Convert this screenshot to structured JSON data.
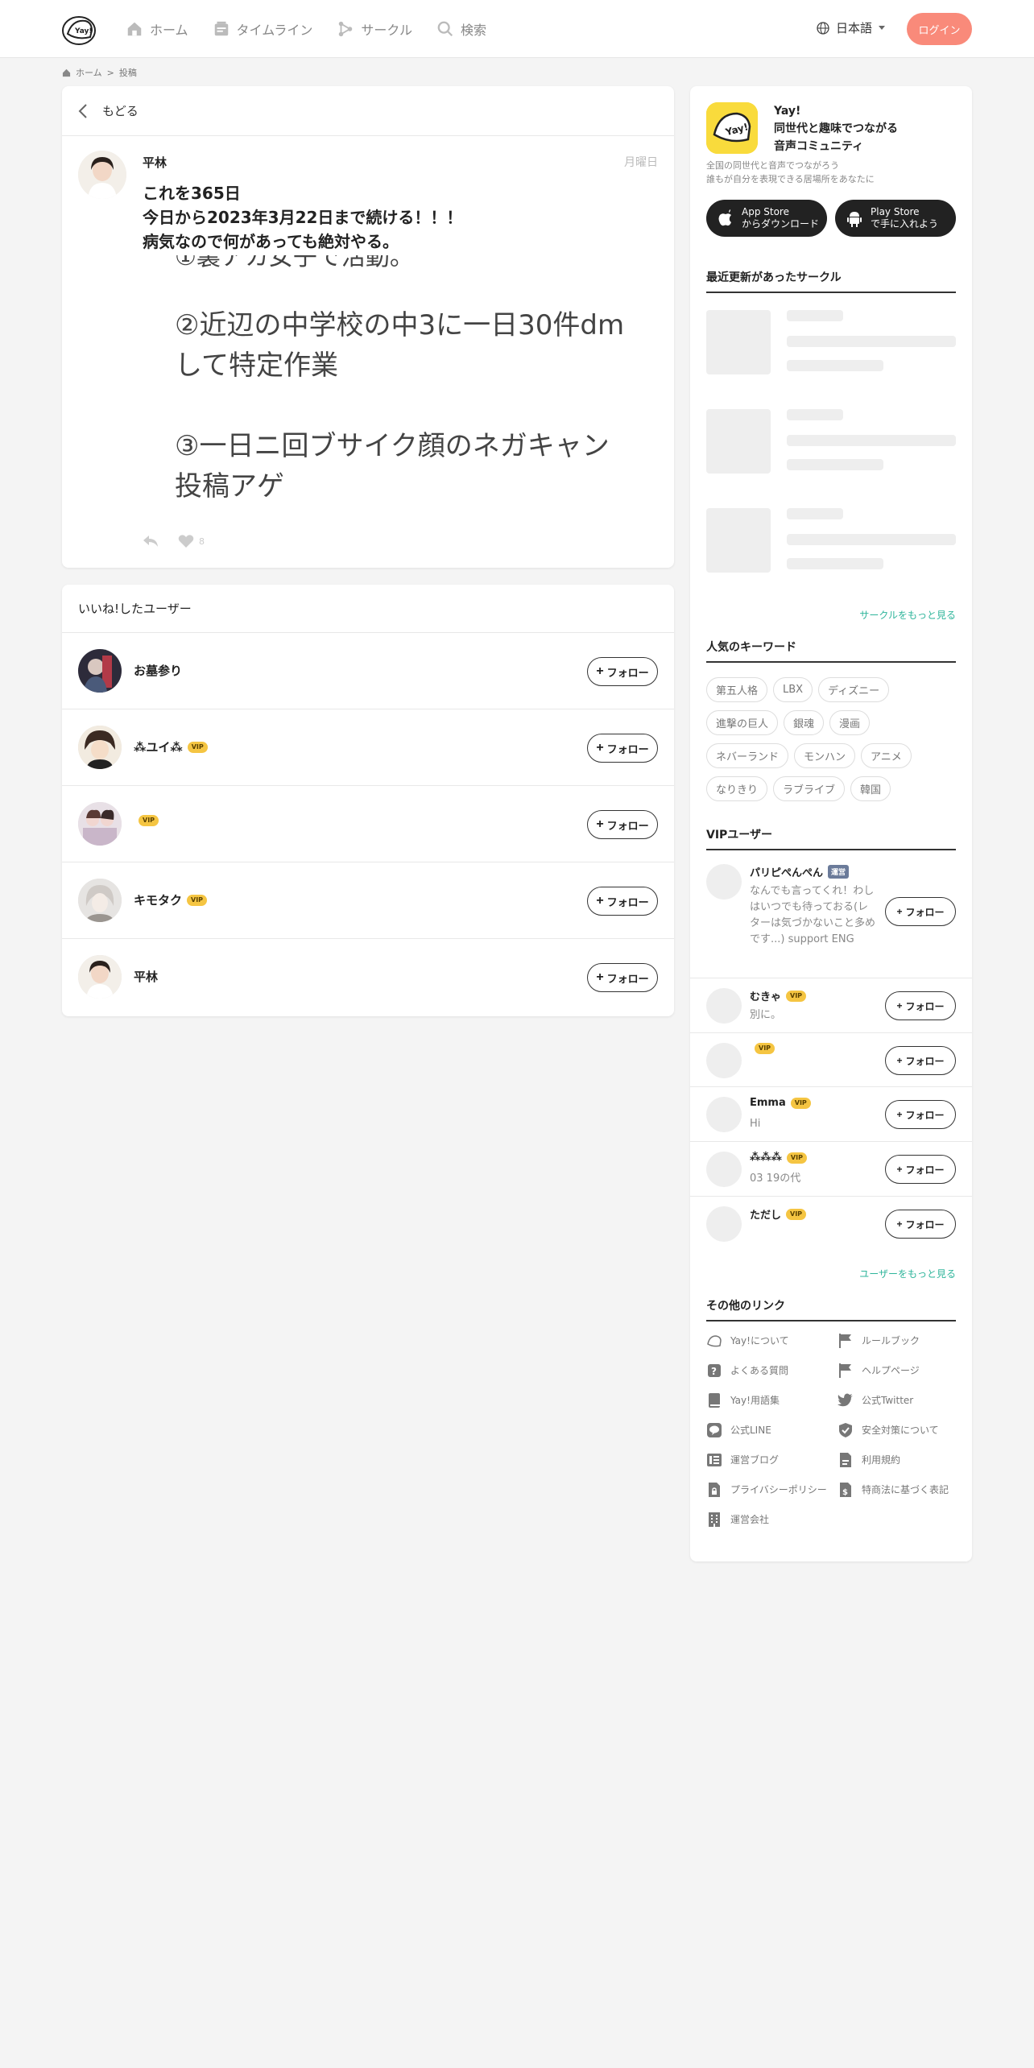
{
  "header": {
    "nav": [
      "ホーム",
      "タイムライン",
      "サークル",
      "検索"
    ],
    "language": "日本語",
    "login": "ログイン"
  },
  "breadcrumb": {
    "home": "ホーム",
    "sep": ">",
    "current": "投稿"
  },
  "post": {
    "back": "もどる",
    "user": "平林",
    "day": "月曜日",
    "text": "これを365日\n今日から2023年3月22日まで続ける！！！\n病気なので何があっても絶対やる。",
    "image_lines": [
      "①裏アカ女子で活動。",
      "②近辺の中学校の中3に一日30件dm",
      "して特定作業",
      "③一日ニ回ブサイク顔のネガキャン",
      "投稿アゲ"
    ],
    "like_count": "8"
  },
  "likers": {
    "title": "いいね!したユーザー",
    "follow": "フォロー",
    "vip": "VIP",
    "users": [
      {
        "name": "お墓参り",
        "vip": false
      },
      {
        "name": "⁂ユイ⁂",
        "vip": true
      },
      {
        "name": "",
        "vip": true
      },
      {
        "name": "キモタク",
        "vip": true
      },
      {
        "name": "平林",
        "vip": false
      }
    ]
  },
  "sidebar": {
    "app_name": "Yay!\n同世代と趣味でつながる\n音声コミュニティ",
    "app_desc": "全国の同世代と音声でつながろう\n誰もが自分を表現できる居場所をあなたに",
    "app_store": "App Store\nからダウンロード",
    "play_store": "Play Store\nで手に入れよう",
    "circles_title": "最近更新があったサークル",
    "circles_more": "サークルをもっと見る",
    "keywords_title": "人気のキーワード",
    "keywords": [
      "第五人格",
      "LBX",
      "ディズニー",
      "進撃の巨人",
      "銀魂",
      "漫画",
      "ネバーランド",
      "モンハン",
      "アニメ",
      "なりきり",
      "ラブライブ",
      "韓国"
    ],
    "vip_title": "VIPユーザー",
    "staff_badge": "運営",
    "vip_users": [
      {
        "name": "パリピぺんぺん",
        "bio": "なんでも言ってくれ！わしはいつでも待っておる(レターは気づかないこと多めです...) support ENG"
      },
      {
        "name": "むきゃ",
        "bio": "別に。"
      },
      {
        "name": "",
        "bio": ""
      },
      {
        "name": "Emma",
        "bio": "Hi"
      },
      {
        "name": "⁂⁂⁂",
        "bio": "03 19の代"
      },
      {
        "name": "ただし",
        "bio": ""
      }
    ],
    "users_more": "ユーザーをもっと見る",
    "links_title": "その他のリンク",
    "links": [
      {
        "label": "Yay!について",
        "icon": "yay-logo-icon"
      },
      {
        "label": "ルールブック",
        "icon": "flag-icon"
      },
      {
        "label": "よくある質問",
        "icon": "question-icon"
      },
      {
        "label": "ヘルプページ",
        "icon": "flag-icon"
      },
      {
        "label": "Yay!用語集",
        "icon": "book-icon"
      },
      {
        "label": "公式Twitter",
        "icon": "twitter-icon"
      },
      {
        "label": "公式LINE",
        "icon": "line-icon"
      },
      {
        "label": "安全対策について",
        "icon": "shield-icon"
      },
      {
        "label": "運営ブログ",
        "icon": "blog-icon"
      },
      {
        "label": "利用規約",
        "icon": "document-icon"
      },
      {
        "label": "プライバシーポリシー",
        "icon": "lock-document-icon"
      },
      {
        "label": "特商法に基づく表記",
        "icon": "yen-document-icon"
      },
      {
        "label": "運営会社",
        "icon": "building-icon"
      }
    ]
  },
  "colors": {
    "accent": "#f98a7a",
    "link": "#2fb59b",
    "vip": "#f5c542",
    "app_icon": "#f9db3c"
  }
}
